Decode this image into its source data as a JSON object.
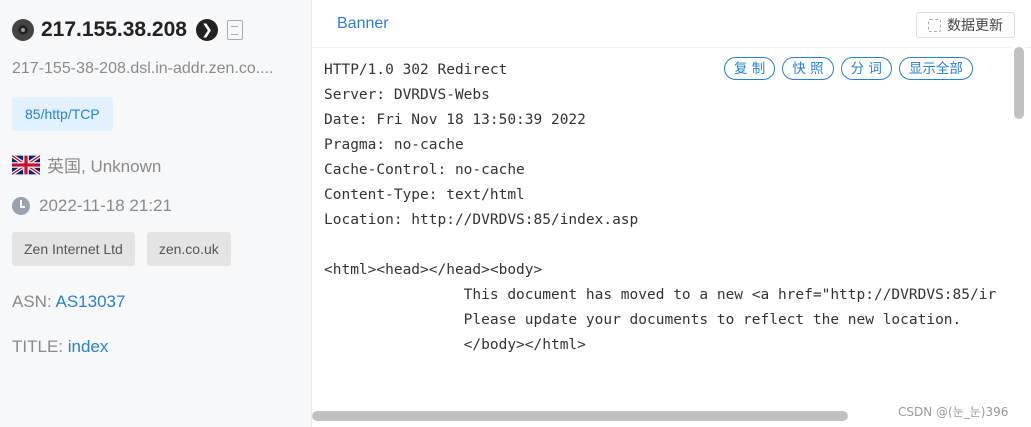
{
  "host_panel": {
    "ip": "217.155.38.208",
    "hostname": "217-155-38-208.dsl.in-addr.zen.co....",
    "port_tag": "85/http/TCP",
    "location": "英国, Unknown",
    "timestamp": "2022-11-18 21:21",
    "org_tags": [
      "Zen Internet Ltd",
      "zen.co.uk"
    ],
    "asn_label": "ASN:",
    "asn_value": "AS13037",
    "title_label": "TITLE:",
    "title_value": "index",
    "icons": [
      "camera-icon",
      "go-arrow-icon",
      "copy-icon",
      "uk-flag-icon",
      "clock-icon"
    ]
  },
  "banner_panel": {
    "tab_label": "Banner",
    "refresh_label": "数据更新",
    "actions": [
      "复 制",
      "快 照",
      "分 词",
      "显示全部"
    ],
    "lines": [
      "HTTP/1.0 302 Redirect",
      "Server: DVRDVS-Webs",
      "Date: Fri Nov 18 13:50:39 2022",
      "Pragma: no-cache",
      "Cache-Control: no-cache",
      "Content-Type: text/html",
      "Location: http://DVRDVS:85/index.asp",
      "",
      "<html><head></head><body>",
      "                This document has moved to a new <a href=\"http://DVRDVS:85/ir",
      "                Please update your documents to reflect the new location.",
      "                </body></html>"
    ]
  },
  "watermark": "CSDN @(눈_눈)396",
  "colors": {
    "link": "#2a7fd0",
    "tag_bg": "#e1f1fd",
    "muted": "#8a8a8a"
  }
}
